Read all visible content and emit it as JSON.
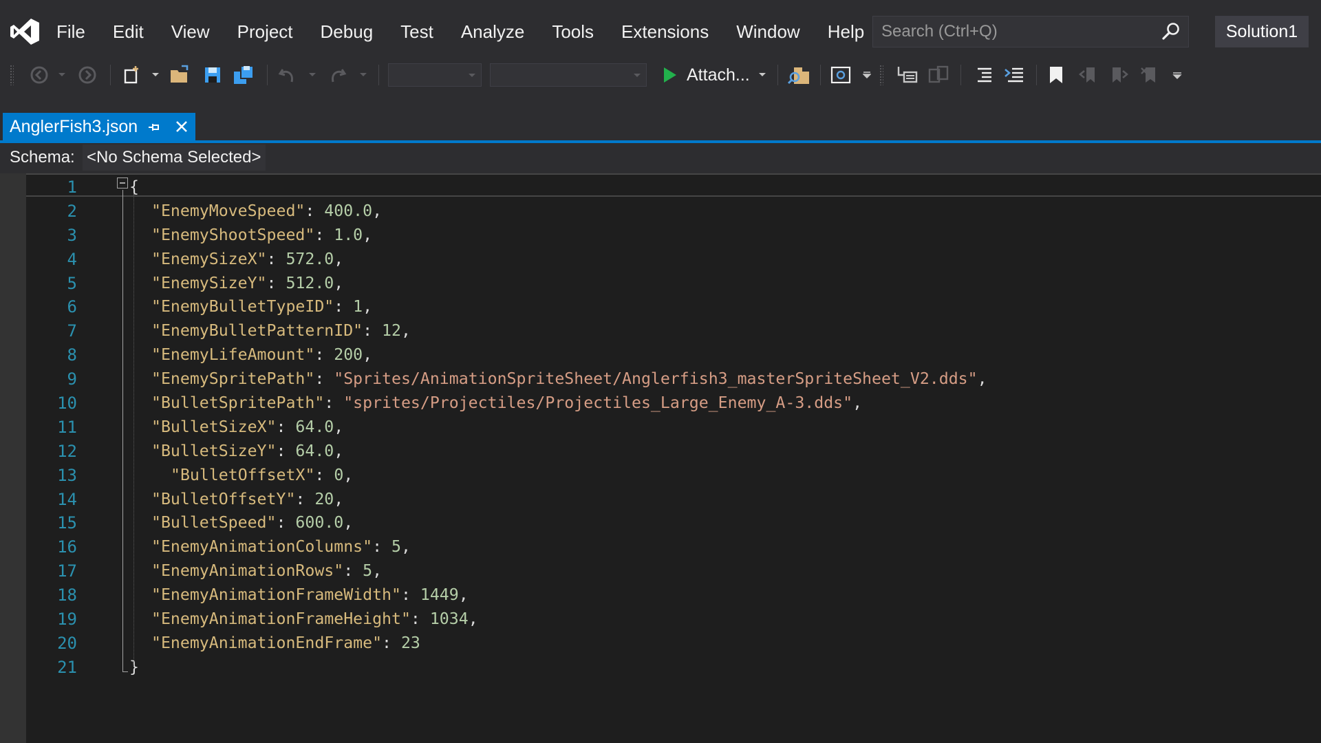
{
  "window": {
    "menu": [
      "File",
      "Edit",
      "View",
      "Project",
      "Debug",
      "Test",
      "Analyze",
      "Tools",
      "Extensions",
      "Window",
      "Help"
    ],
    "search_placeholder": "Search (Ctrl+Q)",
    "solution_name": "Solution1"
  },
  "toolbar": {
    "attach_label": "Attach...",
    "icons": [
      "back-icon",
      "forward-icon",
      "new-project-icon",
      "open-folder-icon",
      "save-icon",
      "save-all-icon",
      "undo-icon",
      "redo-icon",
      "start-icon",
      "find-in-files-icon",
      "browse-icon",
      "step-icon",
      "comment-icon",
      "uncomment-icon",
      "bookmark-icon"
    ]
  },
  "tab": {
    "title": "AnglerFish3.json"
  },
  "schema": {
    "label": "Schema:",
    "value": "<No Schema Selected>"
  },
  "colors": {
    "accent": "#007acc",
    "line_number": "#2b91af",
    "json_key": "#d7ba7d",
    "json_number": "#b5cea8",
    "json_string": "#d69d85"
  },
  "editor": {
    "lines": [
      {
        "n": "1",
        "text": "{"
      },
      {
        "n": "2",
        "key": "\"EnemyMoveSpeed\"",
        "value": "400.0",
        "type": "num",
        "comma": ","
      },
      {
        "n": "3",
        "key": "\"EnemyShootSpeed\"",
        "value": "1.0",
        "type": "num",
        "comma": ","
      },
      {
        "n": "4",
        "key": "\"EnemySizeX\"",
        "value": "572.0",
        "type": "num",
        "comma": ","
      },
      {
        "n": "5",
        "key": "\"EnemySizeY\"",
        "value": "512.0",
        "type": "num",
        "comma": ","
      },
      {
        "n": "6",
        "key": "\"EnemyBulletTypeID\"",
        "value": "1",
        "type": "num",
        "comma": ","
      },
      {
        "n": "7",
        "key": "\"EnemyBulletPatternID\"",
        "value": "12",
        "type": "num",
        "comma": ","
      },
      {
        "n": "8",
        "key": "\"EnemyLifeAmount\"",
        "value": "200",
        "type": "num",
        "comma": ","
      },
      {
        "n": "9",
        "key": "\"EnemySpritePath\"",
        "value": "\"Sprites/AnimationSpriteSheet/Anglerfish3_masterSpriteSheet_V2.dds\"",
        "type": "str",
        "comma": ","
      },
      {
        "n": "10",
        "key": "\"BulletSpritePath\"",
        "value": "\"sprites/Projectiles/Projectiles_Large_Enemy_A-3.dds\"",
        "type": "str",
        "comma": ","
      },
      {
        "n": "11",
        "key": "\"BulletSizeX\"",
        "value": "64.0",
        "type": "num",
        "comma": ","
      },
      {
        "n": "12",
        "key": "\"BulletSizeY\"",
        "value": "64.0",
        "type": "num",
        "comma": ","
      },
      {
        "n": "13",
        "key": "\"BulletOffsetX\"",
        "value": "0",
        "type": "num",
        "comma": ",",
        "extra_indent": true
      },
      {
        "n": "14",
        "key": "\"BulletOffsetY\"",
        "value": "20",
        "type": "num",
        "comma": ","
      },
      {
        "n": "15",
        "key": "\"BulletSpeed\"",
        "value": "600.0",
        "type": "num",
        "comma": ","
      },
      {
        "n": "16",
        "key": "\"EnemyAnimationColumns\"",
        "value": "5",
        "type": "num",
        "comma": ","
      },
      {
        "n": "17",
        "key": "\"EnemyAnimationRows\"",
        "value": "5",
        "type": "num",
        "comma": ","
      },
      {
        "n": "18",
        "key": "\"EnemyAnimationFrameWidth\"",
        "value": "1449",
        "type": "num",
        "comma": ","
      },
      {
        "n": "19",
        "key": "\"EnemyAnimationFrameHeight\"",
        "value": "1034",
        "type": "num",
        "comma": ","
      },
      {
        "n": "20",
        "key": "\"EnemyAnimationEndFrame\"",
        "value": "23",
        "type": "num",
        "comma": ""
      },
      {
        "n": "21",
        "text": "}"
      }
    ]
  }
}
